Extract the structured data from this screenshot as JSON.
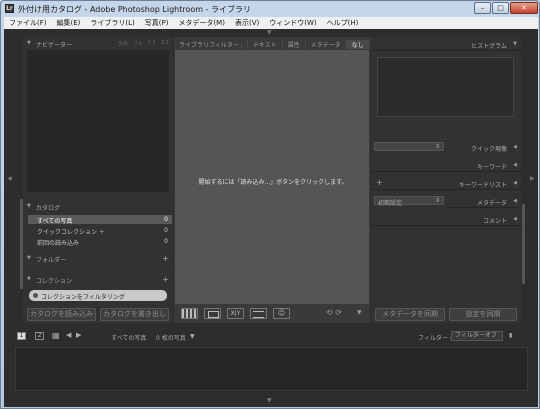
{
  "window": {
    "title": "外付け用カタログ - Adobe Photoshop Lightroom - ライブラリ",
    "app_icon": "Lr",
    "controls": {
      "minimize": "–",
      "maximize": "□",
      "close": "✕"
    }
  },
  "menubar": [
    "ファイル(F)",
    "編集(E)",
    "ライブラリ(L)",
    "写真(P)",
    "メタデータ(M)",
    "表示(V)",
    "ウィンドウ(W)",
    "ヘルプ(H)"
  ],
  "left_panel": {
    "navigator": {
      "title": "ナビゲーター",
      "options": [
        "全体",
        "フル",
        "1:1",
        "3:1"
      ]
    },
    "catalog": {
      "title": "カタログ",
      "items": [
        {
          "name": "すべての写真",
          "count": "0"
        },
        {
          "name": "クイックコレクション ＋",
          "count": "0"
        },
        {
          "name": "前回の読み込み",
          "count": "0"
        }
      ]
    },
    "folders": {
      "title": "フォルダー",
      "plus": "+"
    },
    "collections": {
      "title": "コレクション",
      "plus": "+",
      "filter_label": "コレクションをフィルタリング"
    },
    "import_button": "カタログを読み込み",
    "export_button": "カタログを書き出し"
  },
  "center": {
    "filter_bar": {
      "label": "ライブラリフィルター :",
      "tabs": [
        "テキスト",
        "属性",
        "メタデータ",
        "なし"
      ]
    },
    "empty_message": "開始するには「読み込み...」ボタンをクリックします。"
  },
  "right_panel": {
    "histogram": "ヒストグラム",
    "quick_develop": "クイック現像",
    "keywording": "キーワード",
    "keyword_list": "キーワードリスト",
    "keyword_list_plus": "+",
    "metadata": "メタデータ",
    "metadata_preset": "初期設定",
    "comments": "コメント",
    "sync_metadata_button": "メタデータを同期",
    "sync_settings_button": "設定を同期"
  },
  "filmstrip": {
    "screen1": "1",
    "screen2": "2",
    "breadcrumb": "すべての写真",
    "photo_count": "0 枚の写真",
    "filter_label": "フィルター :",
    "filter_value": "フィルターオフ"
  }
}
